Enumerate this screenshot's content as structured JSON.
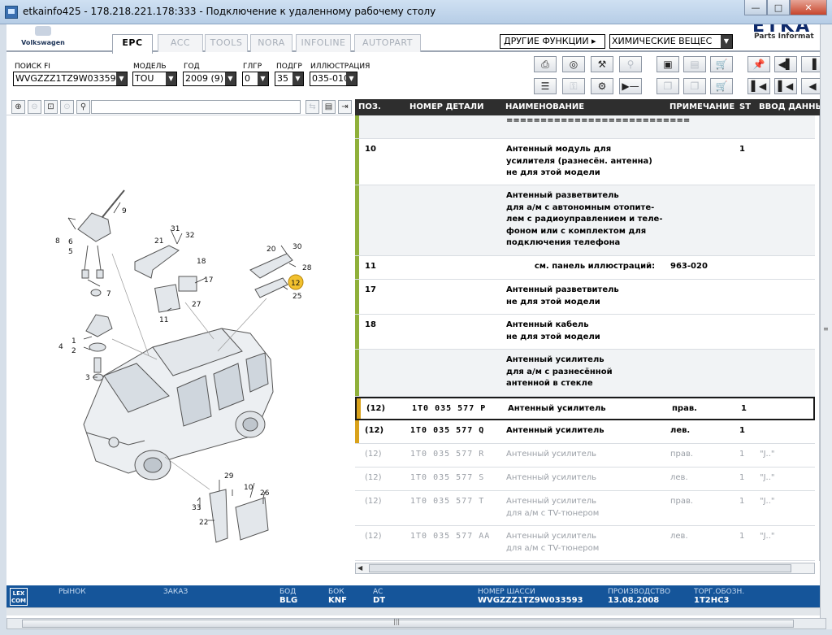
{
  "window": {
    "title": "etkainfo425 - 178.218.221.178:333 - Подключение к удаленному рабочему столу",
    "minimize": "—",
    "maximize": "□",
    "close": "✕"
  },
  "brand": {
    "vw": "Volkswagen",
    "etka": "ETKA",
    "etka_sub": "Parts Informat"
  },
  "tabs": [
    "EPC",
    "ACC",
    "TOOLS",
    "NORA",
    "INFOLINE",
    "AUTOPART"
  ],
  "functions_label": "ДРУГИЕ ФУНКЦИИ ▸",
  "functions_combo": "ХИМИЧЕСКИЕ ВЕЩЕС",
  "filters": {
    "search_label": "ПОИСК FI",
    "search_value": "WVGZZZ1TZ9W03359",
    "model_label": "МОДЕЛЬ",
    "model_value": "TOU",
    "year_label": "ГОД",
    "year_value": "2009 (9)",
    "mg_label": "ГЛГР",
    "mg_value": "0",
    "sg_label": "ПОДГР",
    "sg_value": "35",
    "illus_label": "ИЛЛЮСТРАЦИЯ",
    "illus_value": "035-010"
  },
  "illustration": {
    "callouts": [
      "9",
      "8",
      "6",
      "5",
      "7",
      "31",
      "32",
      "21",
      "18",
      "17",
      "11",
      "27",
      "20",
      "30",
      "28",
      "12",
      "25",
      "1",
      "4",
      "2",
      "3",
      "29",
      "10",
      "26",
      "33",
      "22"
    ],
    "highlight": "12"
  },
  "table": {
    "headers": {
      "pos": "ПОЗ.",
      "part_no": "НОМЕР ДЕТАЛИ",
      "name": "НАИМЕНОВАНИЕ",
      "note": "ПРИМЕЧАНИЕ",
      "st": "ST",
      "date": "ВВОД ДАННЫ"
    },
    "rows": [
      {
        "pos": "",
        "pn": "",
        "desc": "===========================",
        "note": "",
        "st": "",
        "date": ""
      },
      {
        "pos": "10",
        "pn": "",
        "desc": "Антенный модуль для\nусилителя (разнесён. антенна)\nне для этой модели",
        "note": "",
        "st": "1",
        "date": ""
      },
      {
        "pos": "",
        "pn": "",
        "desc": "Антенный разветвитель\nдля а/м с автономным отопите-\nлем с радиоуправлением и теле-\nфоном или с комплектом для\nподключения телефона",
        "note": "",
        "st": "",
        "date": ""
      },
      {
        "pos": "11",
        "pn": "",
        "desc": "          см. панель иллюстраций:",
        "note": "963-020",
        "st": "",
        "date": ""
      },
      {
        "pos": "17",
        "pn": "",
        "desc": "Антенный разветвитель\nне для этой модели",
        "note": "",
        "st": "",
        "date": ""
      },
      {
        "pos": "18",
        "pn": "",
        "desc": "Антенный кабель\nне для этой модели",
        "note": "",
        "st": "",
        "date": ""
      },
      {
        "pos": "",
        "pn": "",
        "desc": "Антенный усилитель\nдля а/м с разнесённой\nантенной в стекле",
        "note": "",
        "st": "",
        "date": ""
      },
      {
        "pos": "(12)",
        "pn": "1T0 035 577 P",
        "desc": "Антенный усилитель",
        "note": "прав.",
        "st": "1",
        "date": ""
      },
      {
        "pos": "(12)",
        "pn": "1T0 035 577 Q",
        "desc": "Антенный усилитель",
        "note": "лев.",
        "st": "1",
        "date": ""
      },
      {
        "pos": "(12)",
        "pn": "1T0 035 577 R",
        "desc": "Антенный усилитель",
        "note": "прав.",
        "st": "1",
        "date": "\"J..\""
      },
      {
        "pos": "(12)",
        "pn": "1T0 035 577 S",
        "desc": "Антенный усилитель",
        "note": "лев.",
        "st": "1",
        "date": "\"J..\""
      },
      {
        "pos": "(12)",
        "pn": "1T0 035 577 T",
        "desc": "Антенный усилитель\nдля а/м с TV-тюнером",
        "note": "прав.",
        "st": "1",
        "date": "\"J..\""
      },
      {
        "pos": "(12)",
        "pn": "1T0 035 577 AA",
        "desc": "Антенный усилитель\nдля а/м с TV-тюнером",
        "note": "лев.",
        "st": "1",
        "date": "\"J..\""
      }
    ]
  },
  "status": {
    "market_label": "РЫНОК",
    "order_label": "ЗАКАЗ",
    "bod_label": "БОД",
    "bod_value": "BLG",
    "bok_label": "БОК",
    "bok_value": "KNF",
    "ac_label": "AC",
    "ac_value": "DT",
    "chassis_label": "НОМЕР ШАССИ",
    "chassis_value": "WVGZZZ1TZ9W033593",
    "prod_label": "ПРОИЗВОДСТВО",
    "prod_value": "13.08.2008",
    "trade_label": "ТОРГ.ОБОЗН.",
    "trade_value": "1T2HC3",
    "lexcom": "LEX COM"
  }
}
